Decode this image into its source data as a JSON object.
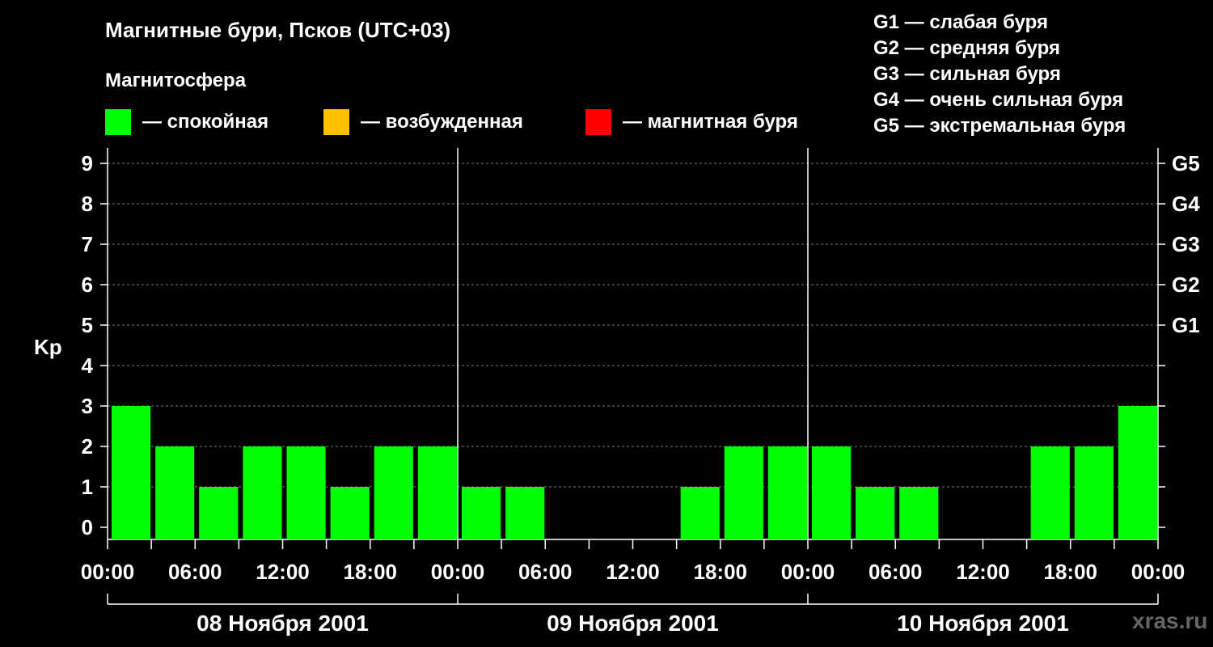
{
  "title": "Магнитные бури, Псков (UTC+03)",
  "subtitle": "Магнитосфера",
  "legend": [
    {
      "label": "— спокойная",
      "color": "#00ff00"
    },
    {
      "label": "— возбужденная",
      "color": "#ffbf00"
    },
    {
      "label": "— магнитная буря",
      "color": "#ff0000"
    }
  ],
  "g_levels": [
    "G1 — слабая буря",
    "G2 — средняя буря",
    "G3 — сильная буря",
    "G4 — очень сильная буря",
    "G5 — экстремальная буря"
  ],
  "watermark": "xras.ru",
  "chart_data": {
    "type": "bar",
    "ylabel": "Kp",
    "ylim": [
      0,
      9
    ],
    "y_ticks": [
      0,
      1,
      2,
      3,
      4,
      5,
      6,
      7,
      8,
      9
    ],
    "right_axis_labels": [
      {
        "y": 5,
        "label": "G1"
      },
      {
        "y": 6,
        "label": "G2"
      },
      {
        "y": 7,
        "label": "G3"
      },
      {
        "y": 8,
        "label": "G4"
      },
      {
        "y": 9,
        "label": "G5"
      }
    ],
    "x_tick_labels": [
      "00:00",
      "06:00",
      "12:00",
      "18:00",
      "00:00",
      "06:00",
      "12:00",
      "18:00",
      "00:00",
      "06:00",
      "12:00",
      "18:00",
      "00:00"
    ],
    "days": [
      "08 Ноября 2001",
      "09 Ноября 2001",
      "10 Ноября 2001"
    ],
    "bar_interval_hours": 3,
    "values": [
      3,
      2,
      1,
      2,
      2,
      1,
      2,
      2,
      1,
      1,
      0,
      0,
      0,
      1,
      2,
      2,
      2,
      1,
      1,
      0,
      0,
      2,
      2,
      3
    ],
    "bar_color": "#00ff00",
    "grid": true
  }
}
